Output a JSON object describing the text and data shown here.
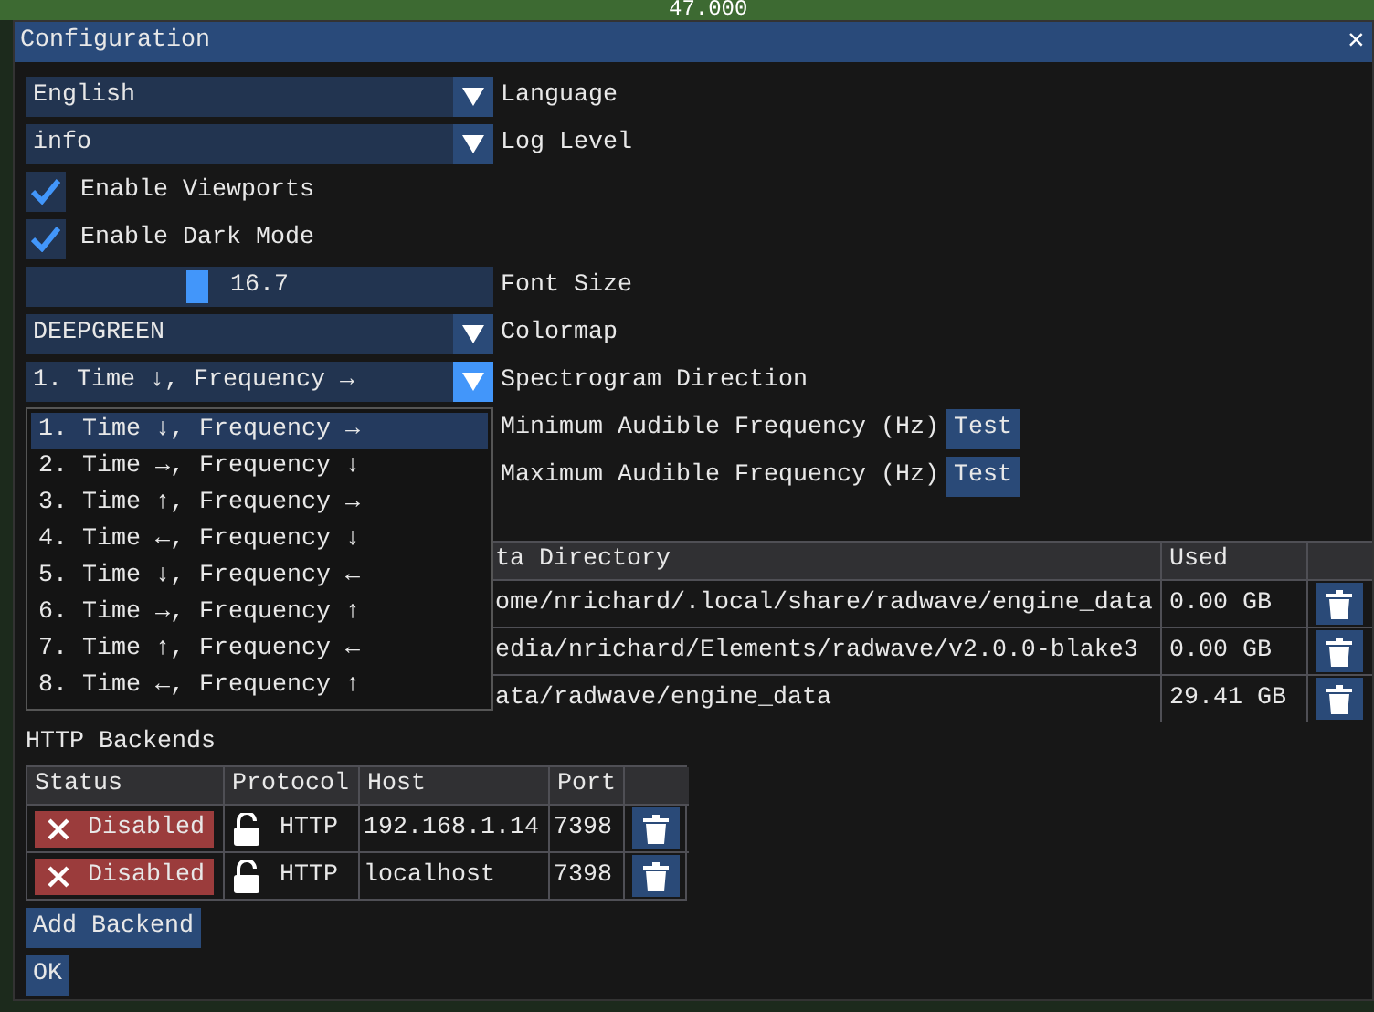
{
  "background": {
    "axis_label": "47.000"
  },
  "window": {
    "title": "Configuration",
    "close": "×"
  },
  "settings": [
    {
      "kind": "combo",
      "current": "English",
      "caption": "Language",
      "expanded": false
    },
    {
      "kind": "combo",
      "current": "info",
      "caption": "Log Level",
      "expanded": false
    },
    {
      "kind": "checkbox",
      "caption": "Enable Viewports",
      "checked": true
    },
    {
      "kind": "checkbox",
      "caption": "Enable Dark Mode",
      "checked": true
    },
    {
      "kind": "slider",
      "reading": "16.7",
      "level": 0.36,
      "caption": "Font Size"
    },
    {
      "kind": "combo",
      "current": "DEEPGREEN",
      "caption": "Colormap",
      "expanded": false
    },
    {
      "kind": "combo",
      "current": "1. Time ↓, Frequency →",
      "caption": "Spectrogram Direction",
      "expanded": true,
      "options": [
        {
          "text": "1. Time ↓, Frequency →",
          "selected": true
        },
        {
          "text": "2. Time →, Frequency ↓",
          "selected": false
        },
        {
          "text": "3. Time ↑, Frequency →",
          "selected": false
        },
        {
          "text": "4. Time ←, Frequency ↓",
          "selected": false
        },
        {
          "text": "5. Time ↓, Frequency ←",
          "selected": false
        },
        {
          "text": "6. Time →, Frequency ↑",
          "selected": false
        },
        {
          "text": "7. Time ↑, Frequency ←",
          "selected": false
        },
        {
          "text": "8. Time ←, Frequency ↑",
          "selected": false
        }
      ]
    },
    {
      "kind": "test",
      "caption": "Minimum Audible Frequency (Hz)",
      "button": "Test"
    },
    {
      "kind": "test",
      "caption": "Maximum Audible Frequency (Hz)",
      "button": "Test"
    }
  ],
  "local_backends": {
    "columns": [
      "ta Directory",
      "Used"
    ],
    "rows": [
      {
        "directory": "ome/nrichard/.local/share/radwave/engine_data",
        "used": "0.00 GB"
      },
      {
        "directory": "edia/nrichard/Elements/radwave/v2.0.0-blake3",
        "used": "0.00 GB"
      },
      {
        "directory": "ata/radwave/engine_data",
        "used": "29.41 GB"
      }
    ]
  },
  "http_backends": {
    "title": "HTTP Backends",
    "columns": [
      "Status",
      "Protocol",
      "Host",
      "Port"
    ],
    "rows": [
      {
        "status": "Disabled",
        "enabled": false,
        "locked": false,
        "protocol": "HTTP",
        "host": "192.168.1.14",
        "port": "7398"
      },
      {
        "status": "Disabled",
        "enabled": false,
        "locked": false,
        "protocol": "HTTP",
        "host": "localhost",
        "port": "7398"
      }
    ]
  },
  "buttons": [
    "Add Backend",
    "OK"
  ]
}
